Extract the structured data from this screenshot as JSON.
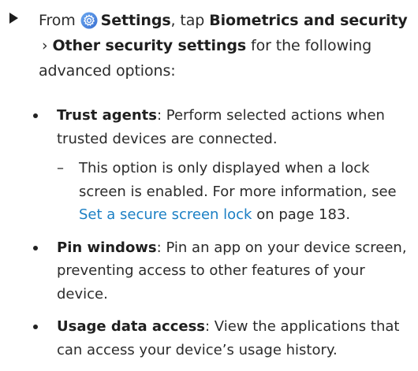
{
  "step": {
    "prefix": "From",
    "settings_label": "Settings",
    "mid": ", tap ",
    "biometrics_label": "Biometrics and security",
    "chevron": "›",
    "other_label": "Other security settings",
    "suffix": " for the following advanced options:"
  },
  "bullets": [
    {
      "term": "Trust agents",
      "desc": ": Perform selected actions when trusted devices are connected.",
      "sub": {
        "dash": "–",
        "text1": "This option is only displayed when a lock screen is enabled. For more information, see ",
        "link": "Set a secure screen lock",
        "text2": " on page 183."
      }
    },
    {
      "term": "Pin windows",
      "desc": ": Pin an app on your device screen, preventing access to other features of your device."
    },
    {
      "term": "Usage data access",
      "desc": ": View the applications that can access your device’s usage history."
    }
  ],
  "colors": {
    "link": "#1b7fc4",
    "icon": "#4a90e2"
  }
}
